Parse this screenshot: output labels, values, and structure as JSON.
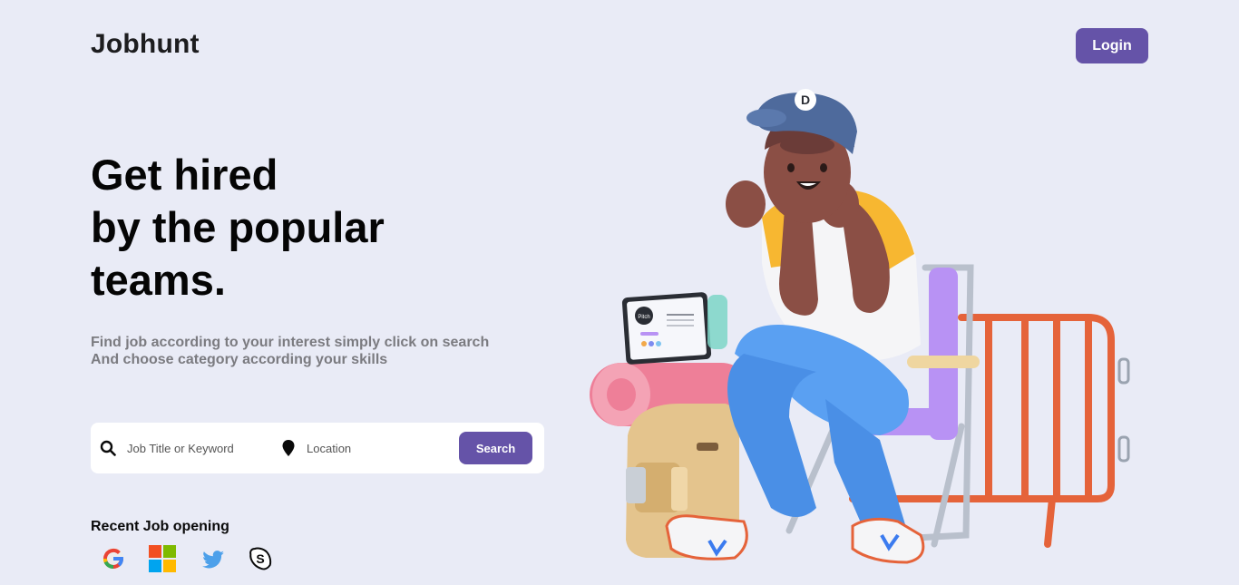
{
  "header": {
    "logo": "Jobhunt",
    "login_label": "Login"
  },
  "hero": {
    "title_lines": [
      "Get hired",
      "by the popular",
      "teams."
    ],
    "subtitle_lines": [
      "Find job according to your interest simply click on search",
      "And choose category according your skills"
    ]
  },
  "search": {
    "keyword_placeholder": "Job Title or Keyword",
    "location_placeholder": "Location",
    "button_label": "Search"
  },
  "recent": {
    "label": "Recent Job opening",
    "companies": [
      "google-icon",
      "microsoft-icon",
      "twitter-icon",
      "skype-icon"
    ]
  },
  "illustration": {
    "tablet_text": "Pitch",
    "cap_letter": "D"
  },
  "colors": {
    "background": "#e9ebf6",
    "accent": "#6553a8",
    "text_dark": "#050505",
    "text_muted": "#7b7b80"
  }
}
